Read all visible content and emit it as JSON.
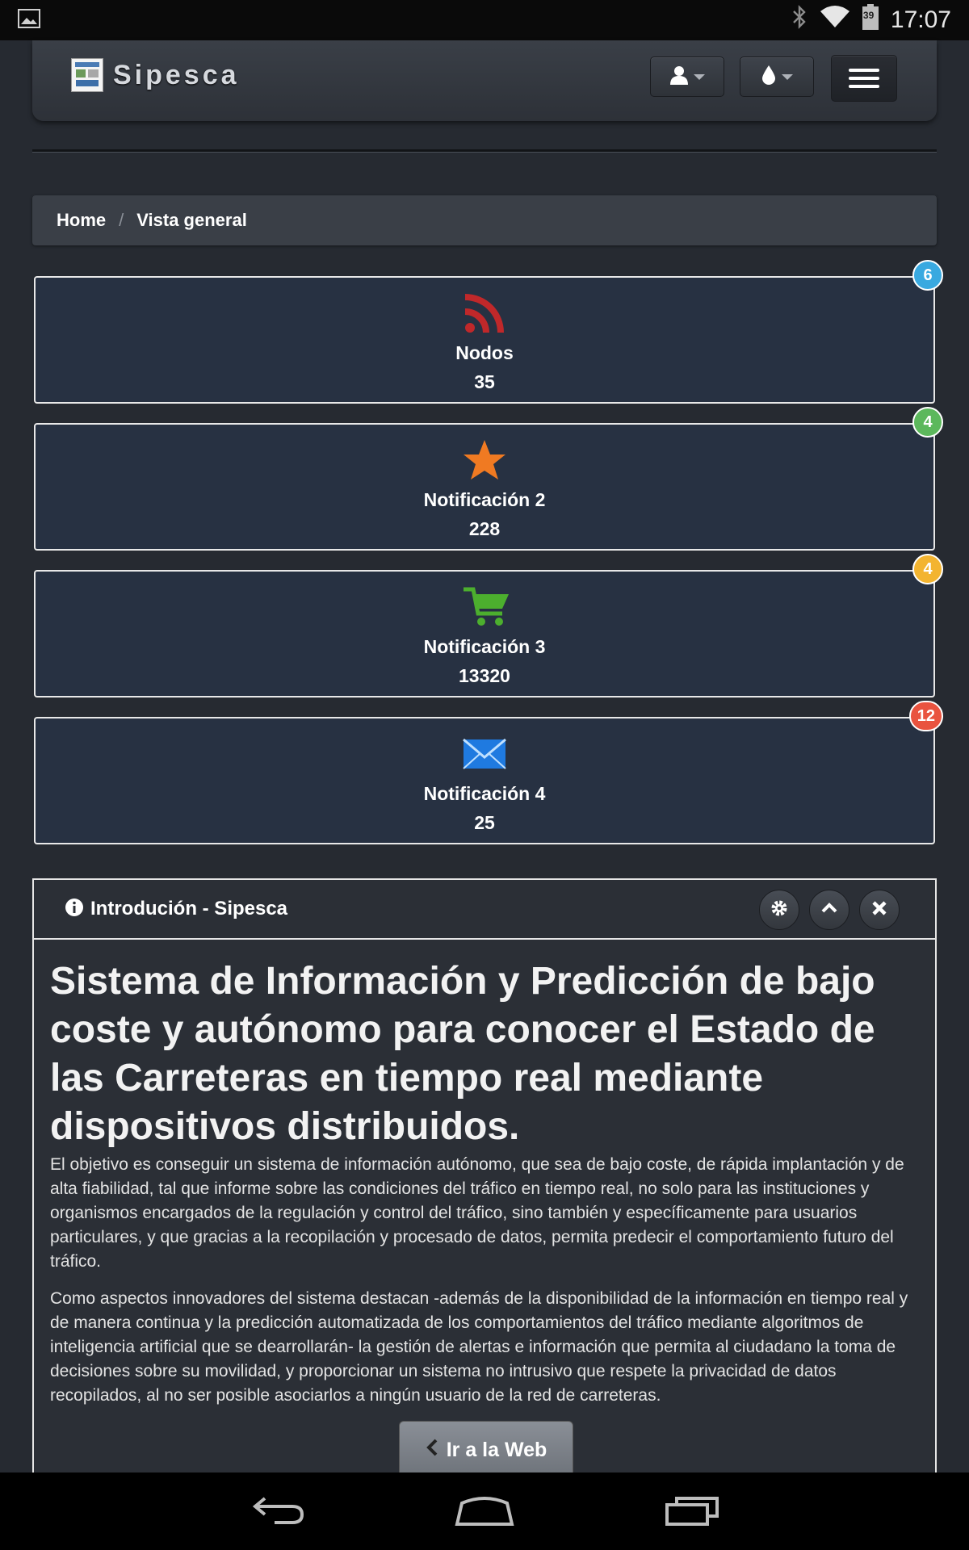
{
  "status_bar": {
    "time": "17:07",
    "battery": "39",
    "icons": [
      "gallery-icon",
      "bluetooth-icon",
      "wifi-icon",
      "battery-icon"
    ]
  },
  "navbar": {
    "brand": "Sipesca",
    "buttons": [
      "user-menu",
      "theme-drop-menu",
      "hamburger-menu"
    ]
  },
  "breadcrumb": {
    "home": "Home",
    "separator": "/",
    "current": "Vista general"
  },
  "stats": [
    {
      "title": "Nodos",
      "value": "35",
      "badge": "6",
      "badge_color": "#39a9e0",
      "icon": "rss-icon",
      "icon_color": "#c0282a"
    },
    {
      "title": "Notificación 2",
      "value": "228",
      "badge": "4",
      "badge_color": "#5cb85c",
      "icon": "star-icon",
      "icon_color": "#f07a22"
    },
    {
      "title": "Notificación 3",
      "value": "13320",
      "badge": "4",
      "badge_color": "#f3b430",
      "icon": "cart-icon",
      "icon_color": "#4caf2e"
    },
    {
      "title": "Notificación 4",
      "value": "25",
      "badge": "12",
      "badge_color": "#e9533f",
      "icon": "envelope-icon",
      "icon_color": "#1f7ae0"
    }
  ],
  "panel": {
    "title": "Introdución - Sipesca",
    "headline": "Sistema de Información y Predicción de bajo coste y autónomo para conocer el Estado de las Carreteras en tiempo real mediante dispositivos distribuidos.",
    "paragraph1": "El objetivo es conseguir un sistema de información autónomo, que sea de bajo coste, de rápida implantación y de alta fiabilidad, tal que informe sobre las condiciones del tráfico en tiempo real, no solo para las instituciones y organismos encargados de la regulación y control del tráfico, sino también y específicamente para usuarios particulares, y que gracias a la recopilación y procesado de datos, permita predecir el comportamiento futuro del tráfico.",
    "paragraph2": "Como aspectos innovadores del sistema destacan -además de la disponibilidad de la información en tiempo real y de manera continua y la predicción automatizada de los comportamientos del tráfico mediante algoritmos de inteligencia artificial que se dearrollarán- la gestión de alertas e información que permita al ciudadano la toma de decisiones sobre su movilidad, y proporcionar un sistema no intrusivo que respete la privacidad de datos recopilados, al no ser posible asociarlos a ningún usuario de la red de carreteras.",
    "button_label": "Ir a la Web"
  },
  "colors": {
    "background": "#262a31",
    "stat_box": "#273142"
  }
}
